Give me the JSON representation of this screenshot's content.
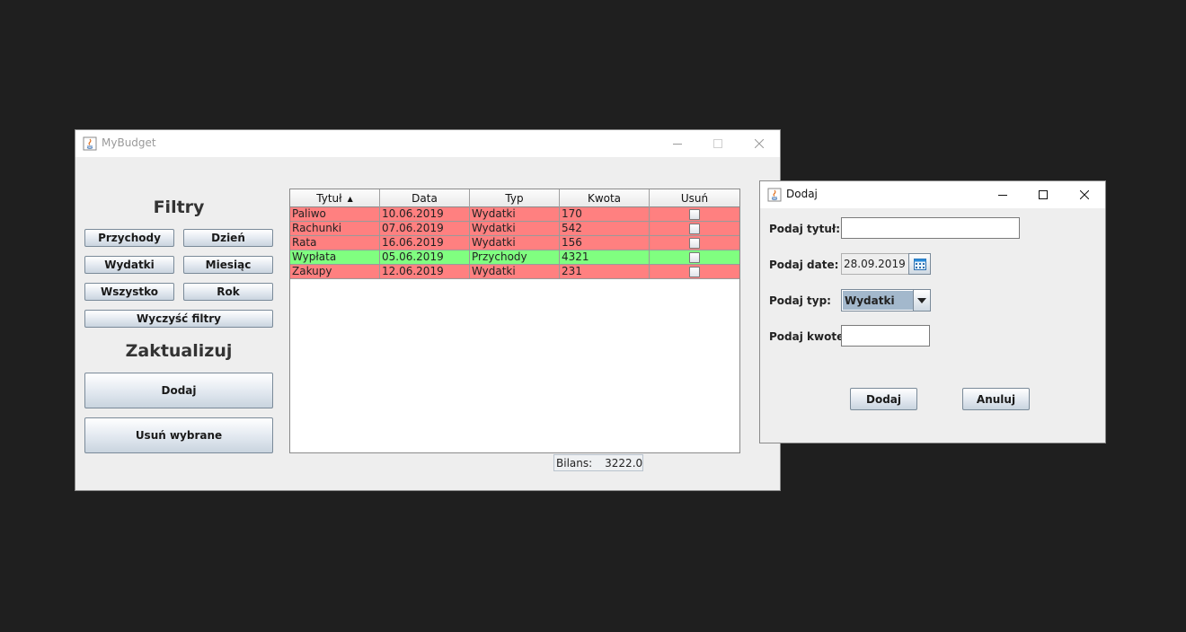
{
  "main_window": {
    "title": "MyBudget",
    "filters_heading": "Filtry",
    "filter_buttons": {
      "income": "Przychody",
      "day": "Dzień",
      "expenses": "Wydatki",
      "month": "Miesiąc",
      "all": "Wszystko",
      "year": "Rok",
      "clear": "Wyczyść filtry"
    },
    "update_heading": "Zaktualizuj",
    "add_button": "Dodaj",
    "remove_selected_button": "Usuń wybrane",
    "table": {
      "columns": [
        "Tytuł",
        "Data",
        "Typ",
        "Kwota",
        "Usuń"
      ],
      "sorted_column": "Tytuł",
      "sort_direction": "ascending",
      "rows": [
        {
          "title": "Paliwo",
          "date": "10.06.2019",
          "type": "Wydatki",
          "amount": "170",
          "delete_checked": false,
          "color": "#ff8080"
        },
        {
          "title": "Rachunki",
          "date": "07.06.2019",
          "type": "Wydatki",
          "amount": "542",
          "delete_checked": false,
          "color": "#ff8080"
        },
        {
          "title": "Rata",
          "date": "16.06.2019",
          "type": "Wydatki",
          "amount": "156",
          "delete_checked": false,
          "color": "#ff8080"
        },
        {
          "title": "Wypłata",
          "date": "05.06.2019",
          "type": "Przychody",
          "amount": "4321",
          "delete_checked": false,
          "color": "#80ff80"
        },
        {
          "title": "Zakupy",
          "date": "12.06.2019",
          "type": "Wydatki",
          "amount": "231",
          "delete_checked": false,
          "color": "#ff8080"
        }
      ]
    },
    "balance_label": "Bilans:",
    "balance_value": "3222.0"
  },
  "dialog": {
    "title": "Dodaj",
    "title_label": "Podaj tytuł:",
    "title_value": "",
    "date_label": "Podaj date:",
    "date_value": "28.09.2019",
    "type_label": "Podaj typ:",
    "type_value": "Wydatki",
    "amount_label": "Podaj kwote:",
    "amount_value": "",
    "add_button": "Dodaj",
    "cancel_button": "Anuluj"
  },
  "colors": {
    "expense_row": "#ff8080",
    "income_row": "#80ff80",
    "desktop": "#1f1f1f",
    "combo_selection": "#a3b8cc"
  },
  "icons": [
    "java-app-icon",
    "minimize-icon",
    "maximize-icon",
    "close-icon",
    "sort-ascending-icon",
    "calendar-icon",
    "dropdown-arrow-icon",
    "checkbox-icon"
  ]
}
